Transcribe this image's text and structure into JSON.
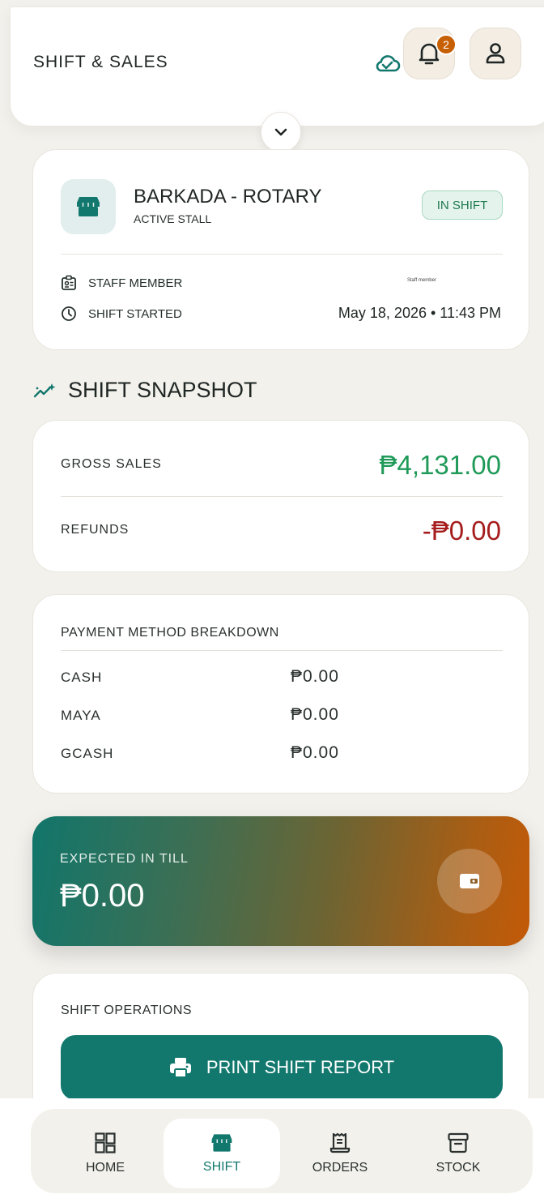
{
  "header": {
    "title": "SHIFT & SALES",
    "notification_count": "2",
    "icons": [
      "cloud-check-icon",
      "bell-icon",
      "user-icon",
      "chevron-down-icon"
    ]
  },
  "stall": {
    "name": "BARKADA - ROTARY",
    "subtitle": "ACTIVE STALL",
    "status": "IN SHIFT",
    "staff_label": "STAFF MEMBER",
    "staff_value": "Staff member",
    "shift_started_label": "SHIFT STARTED",
    "shift_started_value": "May 18, 2026 • 11:43 PM"
  },
  "snapshot": {
    "title": "SHIFT SNAPSHOT",
    "gross_label": "GROSS SALES",
    "gross_value": "₱4,131.00",
    "refunds_label": "REFUNDS",
    "refunds_value": "-₱0.00"
  },
  "payments": {
    "title": "PAYMENT METHOD BREAKDOWN",
    "rows": [
      {
        "method": "CASH",
        "amount": "₱0.00"
      },
      {
        "method": "MAYA",
        "amount": "₱0.00"
      },
      {
        "method": "GCASH",
        "amount": "₱0.00"
      }
    ]
  },
  "till": {
    "label": "EXPECTED IN TILL",
    "value": "₱0.00"
  },
  "operations": {
    "title": "SHIFT OPERATIONS",
    "print_button": "PRINT SHIFT REPORT"
  },
  "nav": {
    "items": [
      {
        "label": "HOME",
        "icon": "dashboard-icon"
      },
      {
        "label": "SHIFT",
        "icon": "store-icon",
        "active": true
      },
      {
        "label": "ORDERS",
        "icon": "receipt-icon"
      },
      {
        "label": "STOCK",
        "icon": "archive-icon"
      }
    ]
  },
  "colors": {
    "accent": "#12786e",
    "gross": "#1f9a59",
    "refund": "#a51d1d",
    "badge": "#c75f05"
  }
}
